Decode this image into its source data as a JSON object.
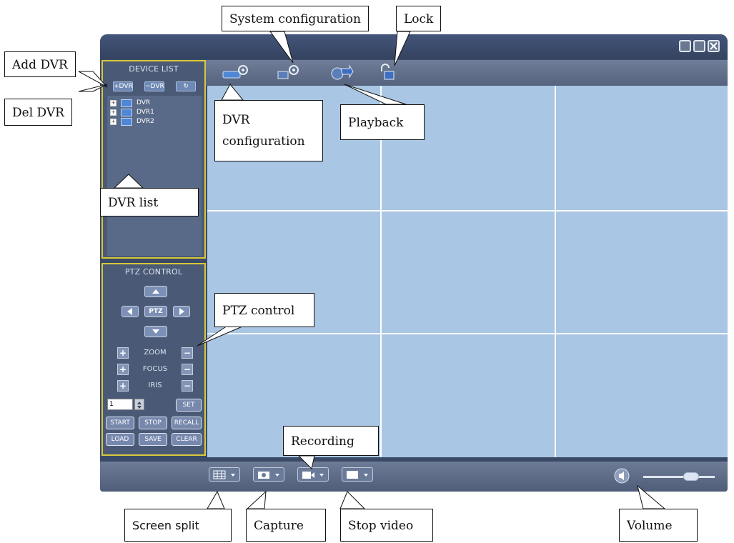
{
  "device_list": {
    "title": "DEVICE LIST",
    "add_btn": "+DVR",
    "del_btn": "−DVR",
    "refresh_btn": "↻",
    "items": [
      "DVR",
      "DVR1",
      "DVR2"
    ]
  },
  "ptz": {
    "title": "PTZ CONTROL",
    "center": "PTZ",
    "zoom": "ZOOM",
    "focus": "FOCUS",
    "iris": "IRIS",
    "plus": "+",
    "minus": "−",
    "preset_value": "1",
    "set": "SET",
    "start": "START",
    "stop": "STOP",
    "recall": "RECALL",
    "load": "LOAD",
    "save": "SAVE",
    "clear": "CLEAR"
  },
  "toolbar": {
    "dvr_config_icon_text": "DVR"
  },
  "callouts": {
    "system_configuration": "System configuration",
    "lock": "Lock",
    "add_dvr": "Add DVR",
    "del_dvr": "Del DVR",
    "dvr_configuration_1": "DVR",
    "dvr_configuration_2": "configuration",
    "playback": "Playback",
    "dvr_list": "DVR list",
    "ptz_control": "PTZ control",
    "recording": "Recording",
    "screen_split": "Screen split",
    "capture": "Capture",
    "stop_video": "Stop video",
    "volume": "Volume"
  },
  "colors": {
    "window_bg": "#3a4a66",
    "video_bg": "#a9c6e4",
    "panel_border": "#d8c83a"
  }
}
